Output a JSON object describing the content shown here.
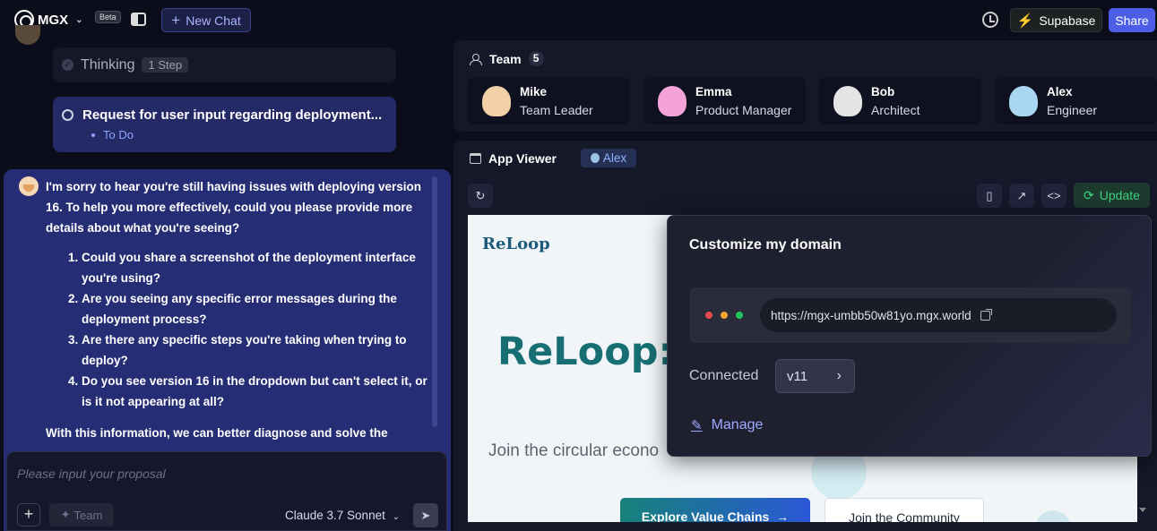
{
  "topbar": {
    "brand": "MGX",
    "beta": "Beta",
    "new_chat": "New Chat",
    "supabase": "Supabase",
    "share": "Share"
  },
  "thinking": {
    "label": "Thinking",
    "steps": "1 Step"
  },
  "todo": {
    "title": "Request for user input regarding deployment...",
    "status": "To Do"
  },
  "message": {
    "intro": "I'm sorry to hear you're still having issues with deploying version 16. To help you more effectively, could you please provide more details about what you're seeing?",
    "questions": [
      "Could you share a screenshot of the deployment interface you're using?",
      "Are you seeing any specific error messages during the deployment process?",
      "Are there any specific steps you're taking when trying to deploy?",
      "Do you see version 16 in the dropdown but can't select it, or is it not appearing at all?"
    ],
    "tail": "With this information, we can better diagnose and solve the"
  },
  "composer": {
    "placeholder": "Please input your proposal",
    "team_chip": "Team",
    "model": "Claude 3.7 Sonnet"
  },
  "team": {
    "label": "Team",
    "count": "5",
    "members": [
      {
        "name": "Mike",
        "role": "Team Leader",
        "color": "#f2d1a8"
      },
      {
        "name": "Emma",
        "role": "Product Manager",
        "color": "#f3a3d8"
      },
      {
        "name": "Bob",
        "role": "Architect",
        "color": "#e4e4e4"
      },
      {
        "name": "Alex",
        "role": "Engineer",
        "color": "#a9d7f2"
      }
    ]
  },
  "viewer": {
    "label": "App Viewer",
    "agent": "Alex",
    "update": "Update"
  },
  "preview": {
    "brand": "ReLoop",
    "hero": "ReLoop:",
    "subtitle": "Join the circular econo",
    "btn_primary": "Explore Value Chains",
    "btn_secondary": "Join the Community"
  },
  "domain_popup": {
    "title": "Customize my domain",
    "url": "https://mgx-umbb50w81yo.mgx.world",
    "connected_label": "Connected",
    "version": "v11",
    "manage": "Manage",
    "dot_colors": [
      "#e5484d",
      "#f5a524",
      "#22c55e"
    ]
  }
}
